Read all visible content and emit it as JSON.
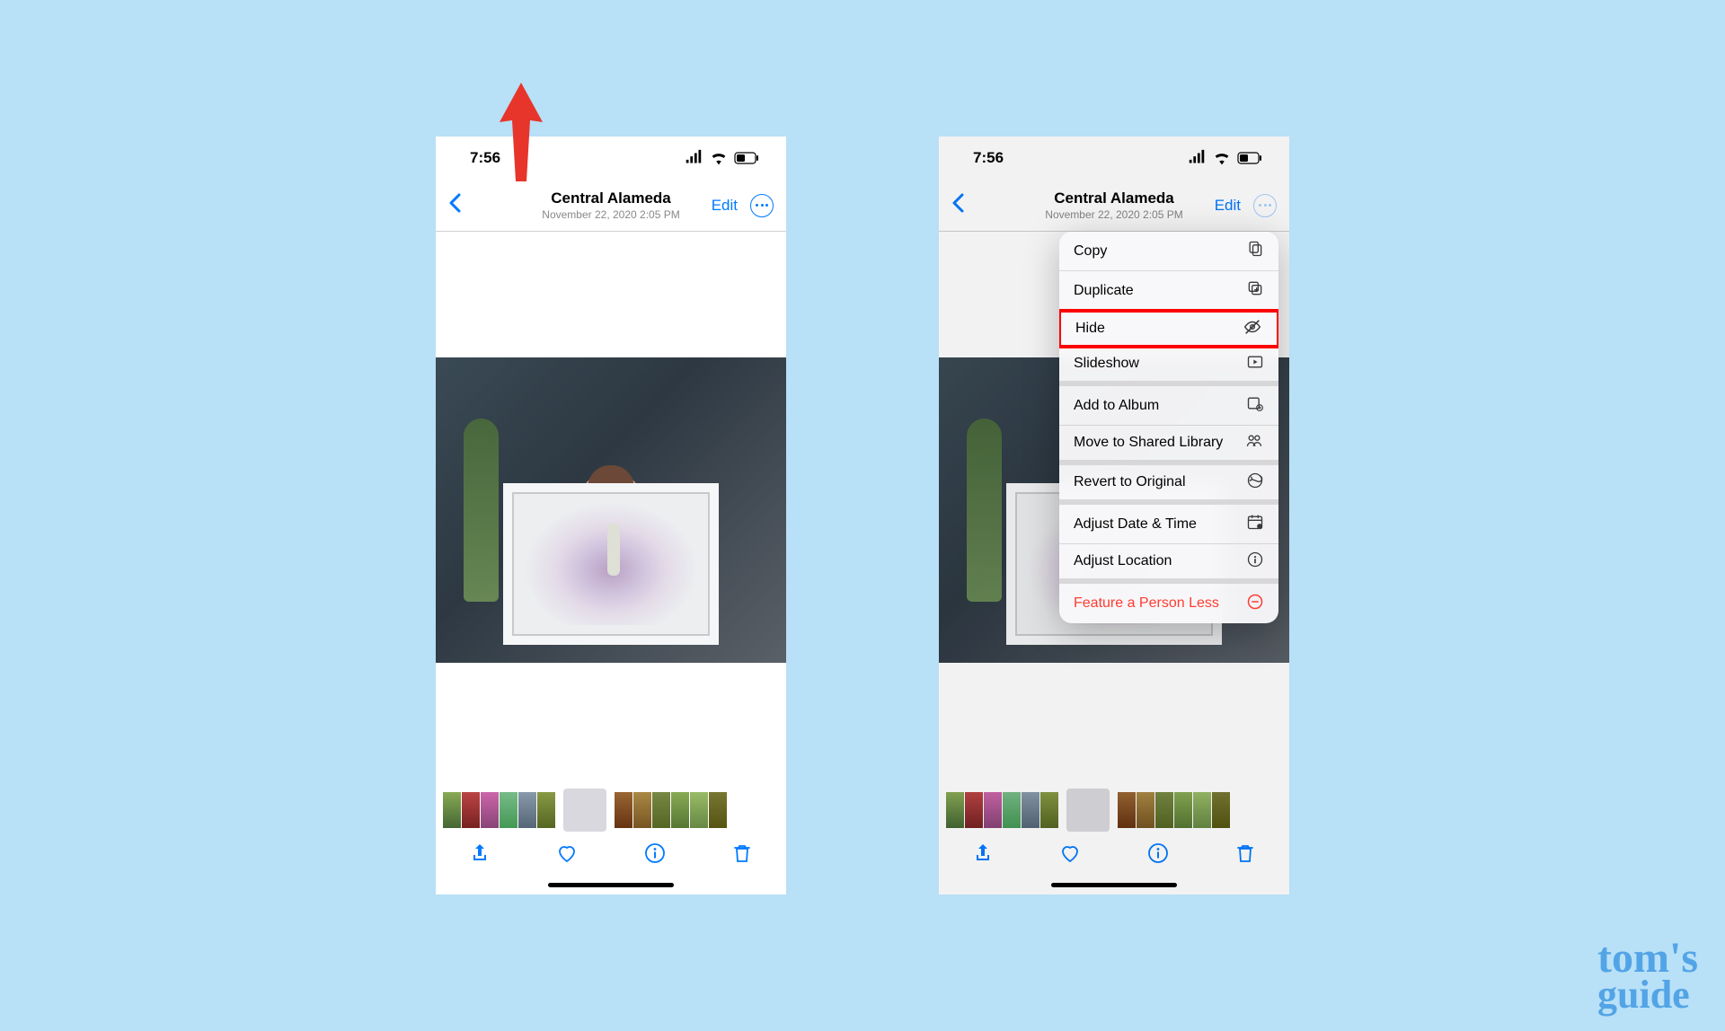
{
  "status": {
    "time": "7:56"
  },
  "nav": {
    "title": "Central Alameda",
    "subtitle": "November 22, 2020  2:05 PM",
    "edit": "Edit"
  },
  "menu": {
    "items": [
      {
        "label": "Copy",
        "icon": "copy-icon"
      },
      {
        "label": "Duplicate",
        "icon": "duplicate-icon"
      },
      {
        "label": "Hide",
        "icon": "hide-icon",
        "highlighted": true
      },
      {
        "label": "Slideshow",
        "icon": "slideshow-icon",
        "group_end": true
      },
      {
        "label": "Add to Album",
        "icon": "add-album-icon"
      },
      {
        "label": "Move to Shared Library",
        "icon": "shared-library-icon",
        "group_end": true
      },
      {
        "label": "Revert to Original",
        "icon": "revert-icon",
        "group_end": true
      },
      {
        "label": "Adjust Date & Time",
        "icon": "calendar-icon"
      },
      {
        "label": "Adjust Location",
        "icon": "location-icon",
        "group_end": true
      },
      {
        "label": "Feature a Person Less",
        "icon": "minus-circle-icon",
        "destructive": true
      }
    ]
  },
  "watermark": {
    "line1": "tom's",
    "line2": "guide"
  }
}
